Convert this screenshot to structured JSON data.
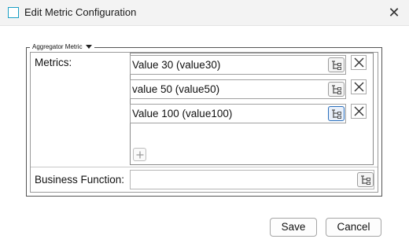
{
  "window": {
    "title": "Edit Metric Configuration",
    "close_glyph": "✕"
  },
  "group": {
    "legend": "Aggregator Metric"
  },
  "form": {
    "metrics_label": "Metrics:",
    "business_function_label": "Business Function:",
    "business_function_value": "",
    "metrics": [
      {
        "value": "Value 30 (value30)"
      },
      {
        "value": "value 50 (value50)"
      },
      {
        "value": "Value 100 (value100)"
      }
    ]
  },
  "icons": {
    "picker": "tree-picker-icon",
    "remove": "close-icon",
    "add": "plus-icon",
    "legend_toggle": "chevron-down-icon"
  },
  "buttons": {
    "save": "Save",
    "cancel": "Cancel"
  },
  "colors": {
    "accent": "#1a9fc4",
    "focus": "#2a6fbd"
  }
}
